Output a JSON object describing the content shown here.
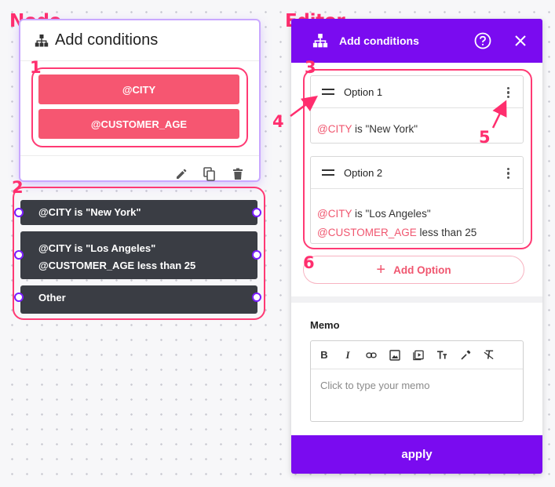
{
  "annotations": {
    "node_title": "Node",
    "editor_title": "Editor",
    "markers": [
      "1",
      "2",
      "3",
      "4",
      "5",
      "6"
    ]
  },
  "node": {
    "icon": "sitemap-icon",
    "title": "Add conditions",
    "condition_pills": [
      "@CITY",
      "@CUSTOMER_AGE"
    ],
    "footer_icons": [
      "pencil-icon",
      "copy-icon",
      "trash-icon"
    ],
    "outputs": [
      {
        "lines": [
          "@CITY is \"New York\""
        ]
      },
      {
        "lines": [
          "@CITY is \"Los Angeles\"",
          "@CUSTOMER_AGE less than 25"
        ]
      },
      {
        "lines": [
          "Other"
        ]
      }
    ]
  },
  "editor": {
    "title": "Add conditions",
    "header_icons": [
      "help-circle-icon",
      "close-icon"
    ],
    "options": [
      {
        "name": "Option 1",
        "conditions": [
          {
            "variable": "@CITY",
            "rest": " is \"New York\""
          }
        ]
      },
      {
        "name": "Option 2",
        "conditions": [
          {
            "variable": "@CITY",
            "rest": " is \"Los Angeles\""
          },
          {
            "variable": "@CUSTOMER_AGE",
            "rest": " less than 25"
          }
        ]
      }
    ],
    "add_option_plus": "+",
    "add_option_label": "Add Option",
    "memo": {
      "label": "Memo",
      "toolbar": [
        "bold-icon",
        "italic-icon",
        "link-icon",
        "image-icon",
        "video-icon",
        "text-size-icon",
        "color-picker-icon",
        "clear-format-icon"
      ],
      "placeholder": "Click to type your memo"
    },
    "apply_label": "apply"
  },
  "colors": {
    "accent_purple": "#7a0bf0",
    "pill_red": "#f65671",
    "annotation_pink": "#ff2e6e",
    "dark_row": "#3a3d44"
  }
}
